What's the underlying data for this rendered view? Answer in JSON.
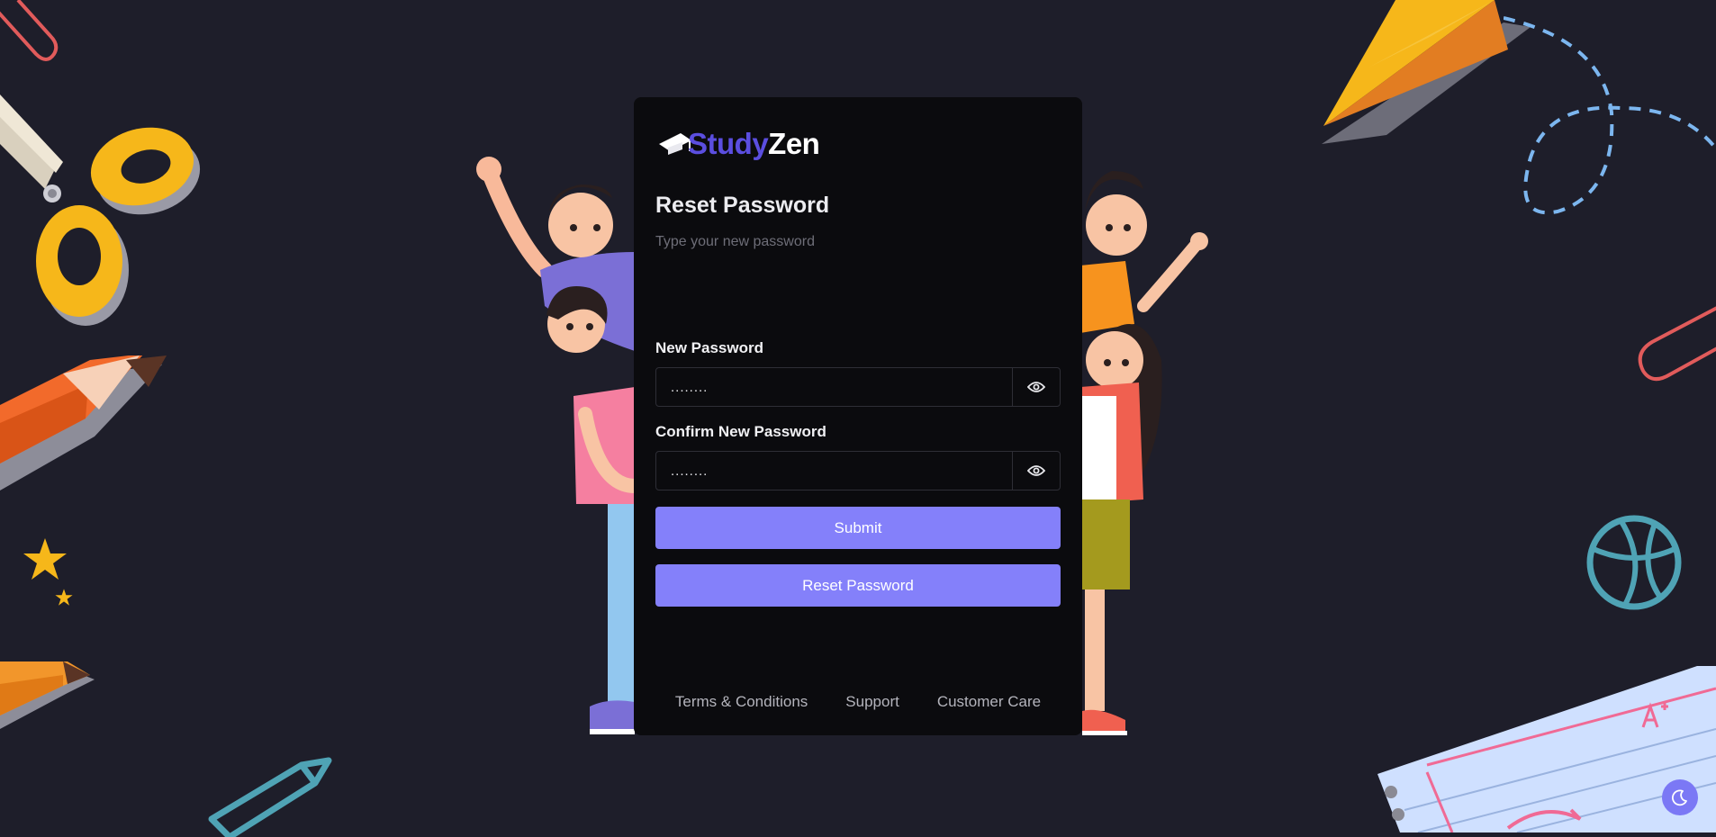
{
  "brand": {
    "part1": "Study",
    "part2": "Zen"
  },
  "form": {
    "title": "Reset Password",
    "subtitle": "Type your new password",
    "new_password": {
      "label": "New Password",
      "value": "........"
    },
    "confirm_password": {
      "label": "Confirm New Password",
      "value": "........"
    },
    "submit_label": "Submit",
    "reset_label": "Reset Password"
  },
  "footer": {
    "links": [
      "Terms & Conditions",
      "Support",
      "Customer Care"
    ]
  },
  "icons": {
    "logo": "graduation-cap-icon",
    "password_toggle": "eye-icon",
    "theme_toggle": "moon-icon"
  },
  "colors": {
    "background": "#1e1e2a",
    "card": "#0b0b0e",
    "accent": "#8480fa",
    "brand_primary": "#5b4ee0"
  }
}
